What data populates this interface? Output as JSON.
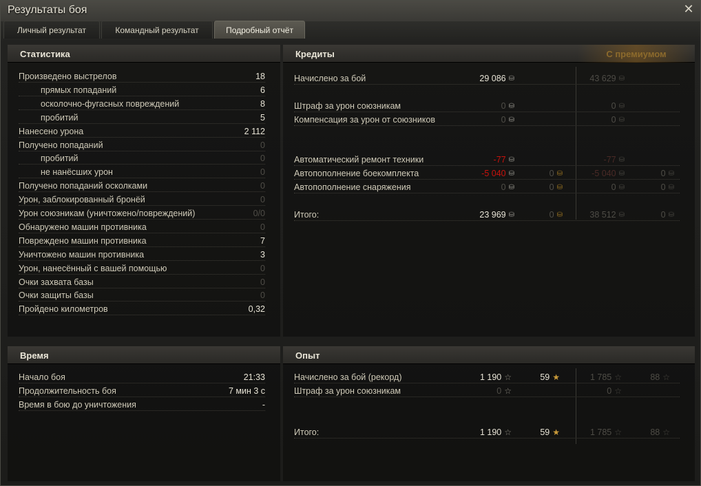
{
  "window": {
    "title": "Результаты боя"
  },
  "tabs": [
    {
      "label": "Личный результат",
      "active": false
    },
    {
      "label": "Командный результат",
      "active": false
    },
    {
      "label": "Подробный отчёт",
      "active": true
    }
  ],
  "stats": {
    "title": "Статистика",
    "rows": [
      {
        "label": "Произведено выстрелов",
        "value": "18",
        "indent": false,
        "dim": false
      },
      {
        "label": "прямых попаданий",
        "value": "6",
        "indent": true,
        "dim": false
      },
      {
        "label": "осколочно-фугасных повреждений",
        "value": "8",
        "indent": true,
        "dim": false
      },
      {
        "label": "пробитий",
        "value": "5",
        "indent": true,
        "dim": false
      },
      {
        "label": "Нанесено урона",
        "value": "2 112",
        "indent": false,
        "dim": false
      },
      {
        "label": "Получено попаданий",
        "value": "0",
        "indent": false,
        "dim": true
      },
      {
        "label": "пробитий",
        "value": "0",
        "indent": true,
        "dim": true
      },
      {
        "label": "не нанёсших урон",
        "value": "0",
        "indent": true,
        "dim": true
      },
      {
        "label": "Получено попаданий осколками",
        "value": "0",
        "indent": false,
        "dim": true
      },
      {
        "label": "Урон, заблокированный бронёй",
        "value": "0",
        "indent": false,
        "dim": true
      },
      {
        "label": "Урон союзникам (уничтожено/повреждений)",
        "value": "0/0",
        "indent": false,
        "dim": true
      },
      {
        "label": "Обнаружено машин противника",
        "value": "0",
        "indent": false,
        "dim": true
      },
      {
        "label": "Повреждено машин противника",
        "value": "7",
        "indent": false,
        "dim": false
      },
      {
        "label": "Уничтожено машин противника",
        "value": "3",
        "indent": false,
        "dim": false
      },
      {
        "label": "Урон, нанесённый с вашей помощью",
        "value": "0",
        "indent": false,
        "dim": true
      },
      {
        "label": "Очки захвата базы",
        "value": "0",
        "indent": false,
        "dim": true
      },
      {
        "label": "Очки защиты базы",
        "value": "0",
        "indent": false,
        "dim": true
      },
      {
        "label": "Пройдено километров",
        "value": "0,32",
        "indent": false,
        "dim": false
      }
    ]
  },
  "time": {
    "title": "Время",
    "rows": [
      {
        "label": "Начало боя",
        "value": "21:33"
      },
      {
        "label": "Продолжительность боя",
        "value": "7 мин 3 с"
      },
      {
        "label": "Время в бою до уничтожения",
        "value": "-"
      }
    ]
  },
  "credits": {
    "title": "Кредиты",
    "premium_label": "С премиумом",
    "rows": [
      {
        "label": "Начислено за бой",
        "credits": "29 086",
        "gold": "",
        "prem_credits": "43 629",
        "prem_gold": "",
        "dim": false,
        "red": false,
        "gap_after": true
      },
      {
        "label": "Штраф за урон союзникам",
        "credits": "0",
        "gold": "",
        "prem_credits": "0",
        "prem_gold": "",
        "dim": true,
        "red": false,
        "gap_after": false
      },
      {
        "label": "Компенсация за урон от союзников",
        "credits": "0",
        "gold": "",
        "prem_credits": "0",
        "prem_gold": "",
        "dim": true,
        "red": false,
        "gap_after": true
      },
      {
        "label": "Автоматический ремонт техники",
        "credits": "-77",
        "gold": "",
        "prem_credits": "-77",
        "prem_gold": "",
        "dim": false,
        "red": true,
        "gap_after": false
      },
      {
        "label": "Автопополнение боекомплекта",
        "credits": "-5 040",
        "gold": "0",
        "prem_credits": "-5 040",
        "prem_gold": "0",
        "dim": false,
        "red": true,
        "gap_after": false
      },
      {
        "label": "Автопополнение снаряжения",
        "credits": "0",
        "gold": "0",
        "prem_credits": "0",
        "prem_gold": "0",
        "dim": true,
        "red": false,
        "gap_after": false
      },
      {
        "label": "Итого:",
        "credits": "23 969",
        "gold": "0",
        "prem_credits": "38 512",
        "prem_gold": "0",
        "dim": false,
        "red": false,
        "gap_after": false
      }
    ]
  },
  "experience": {
    "title": "Опыт",
    "rows": [
      {
        "label": "Начислено за бой (рекорд)",
        "xp": "1 190",
        "free_xp": "59",
        "prem_xp": "1 785",
        "prem_free_xp": "88",
        "dim": false
      },
      {
        "label": "Штраф за урон союзникам",
        "xp": "0",
        "free_xp": "",
        "prem_xp": "0",
        "prem_free_xp": "",
        "dim": true
      },
      {
        "label": "Итого:",
        "xp": "1 190",
        "free_xp": "59",
        "prem_xp": "1 785",
        "prem_free_xp": "88",
        "dim": false
      }
    ]
  },
  "icons": {
    "close": "close-icon",
    "credit": "credit-coin-icon",
    "gold": "gold-coin-icon",
    "xp": "xp-star-icon"
  },
  "colors": {
    "negative": "#c8120c",
    "premium": "#8c6a2c",
    "dim": "#4f4d47"
  }
}
